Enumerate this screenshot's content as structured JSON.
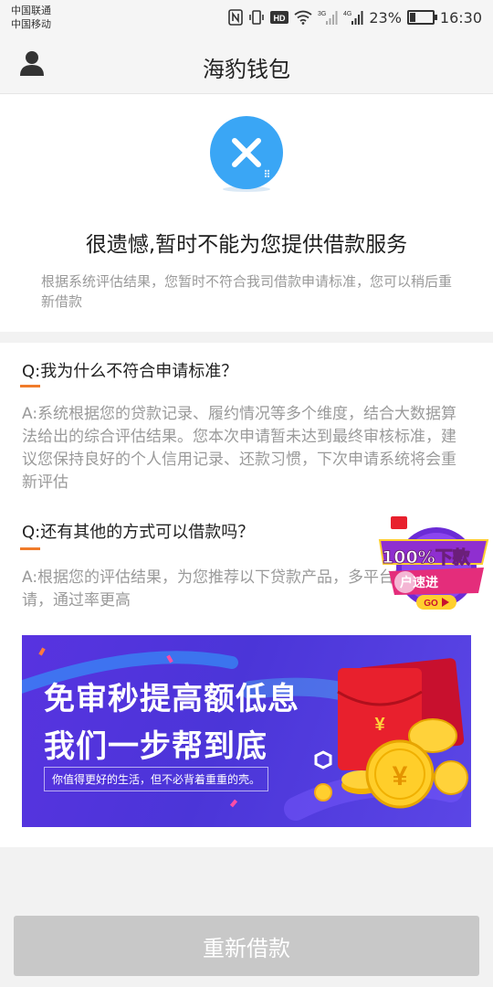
{
  "status_bar": {
    "carrier_1": "中国联通",
    "carrier_2": "中国移动",
    "net_3g": "3G",
    "net_4g": "4G",
    "hd": "HD",
    "battery": "23%",
    "time": "16:30"
  },
  "header": {
    "title": "海豹钱包"
  },
  "result": {
    "title": "很遗憾,暂时不能为您提供借款服务",
    "description": "根据系统评估结果，您暂时不符合我司借款申请标准，您可以稍后重新借款"
  },
  "faq": [
    {
      "question": "Q:我为什么不符合申请标准？",
      "answer": "A:系统根据您的贷款记录、履约情况等多个维度，结合大数据算法给出的综合评估结果。您本次申请暂未达到最终审核标准，建议您保持良好的个人信用记录、还款习惯，下次申请系统将会重新评估"
    },
    {
      "question": "Q:还有其他的方式可以借款吗？",
      "answer": "A:根据您的评估结果，为您推荐以下贷款产品，多平台同时申请，通过率更高"
    }
  ],
  "banner": {
    "line1": "免审秒提高额低息",
    "line2": "我们一步帮到底",
    "tagline": "你值得更好的生活，但不必背着重重的壳。",
    "coin_symbol": "¥"
  },
  "download_badge": {
    "line1": "100%下款",
    "line2": "户速进",
    "go": "GO"
  },
  "bottom": {
    "retry_label": "重新借款"
  },
  "colors": {
    "accent_orange": "#f07b2a",
    "error_blue": "#3aa6f5",
    "button_disabled": "#c8c8c8",
    "banner_purple": "#4b35d8"
  }
}
